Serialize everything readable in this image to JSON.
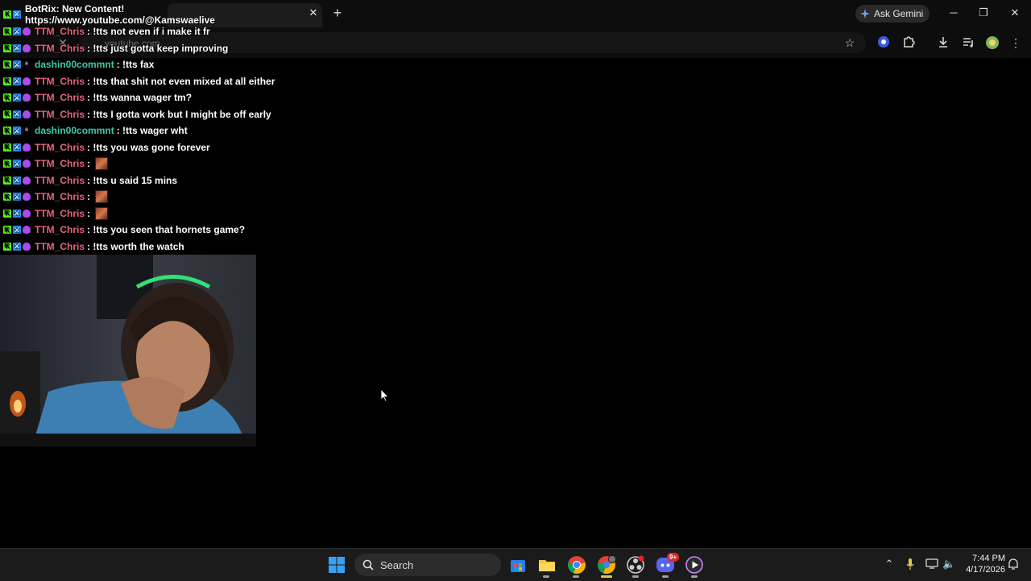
{
  "browser": {
    "tab_title": "BotRix: New Content! https://www.youtube.com/@Kamswaelive",
    "address_text": "youtube.com",
    "gemini_label": "Ask Gemini",
    "window_controls": [
      "minimize-icon",
      "restore-icon",
      "close-icon"
    ],
    "toolbar_icons": [
      "star-icon",
      "extension-circle-icon",
      "puzzle-icon",
      "download-icon",
      "media-queue-icon",
      "profile-avatar-icon",
      "kebab-menu-icon"
    ]
  },
  "chat": {
    "messages": [
      {
        "user": "TTM_Chris",
        "color": "#e8637a",
        "badges": [
          "k",
          "mod",
          "sub"
        ],
        "text": "!tts not even if i make it fr"
      },
      {
        "user": "TTM_Chris",
        "color": "#e8637a",
        "badges": [
          "k",
          "mod",
          "sub"
        ],
        "text": "!tts just gotta keep improving"
      },
      {
        "user": "dashin00commnt",
        "color": "#3ec9a7",
        "badges": [
          "k",
          "mod",
          "dash"
        ],
        "text": "!tts fax"
      },
      {
        "user": "TTM_Chris",
        "color": "#e8637a",
        "badges": [
          "k",
          "mod",
          "sub"
        ],
        "text": "!tts that shit not even mixed at all either"
      },
      {
        "user": "TTM_Chris",
        "color": "#e8637a",
        "badges": [
          "k",
          "mod",
          "sub"
        ],
        "text": "!tts wanna wager tm?"
      },
      {
        "user": "TTM_Chris",
        "color": "#e8637a",
        "badges": [
          "k",
          "mod",
          "sub"
        ],
        "text": "!tts I gotta work but I might be off early"
      },
      {
        "user": "dashin00commnt",
        "color": "#3ec9a7",
        "badges": [
          "k",
          "mod",
          "dash"
        ],
        "text": "!tts wager wht"
      },
      {
        "user": "TTM_Chris",
        "color": "#e8637a",
        "badges": [
          "k",
          "mod",
          "sub"
        ],
        "text": "!tts you was gone forever"
      },
      {
        "user": "TTM_Chris",
        "color": "#e8637a",
        "badges": [
          "k",
          "mod",
          "sub"
        ],
        "text": "",
        "emote": true
      },
      {
        "user": "TTM_Chris",
        "color": "#e8637a",
        "badges": [
          "k",
          "mod",
          "sub"
        ],
        "text": "!tts u said 15 mins"
      },
      {
        "user": "TTM_Chris",
        "color": "#e8637a",
        "badges": [
          "k",
          "mod",
          "sub"
        ],
        "text": "",
        "emote": true
      },
      {
        "user": "TTM_Chris",
        "color": "#e8637a",
        "badges": [
          "k",
          "mod",
          "sub"
        ],
        "text": "",
        "emote": true
      },
      {
        "user": "TTM_Chris",
        "color": "#e8637a",
        "badges": [
          "k",
          "mod",
          "sub"
        ],
        "text": "!tts you seen that hornets game?"
      },
      {
        "user": "TTM_Chris",
        "color": "#e8637a",
        "badges": [
          "k",
          "mod",
          "sub"
        ],
        "text": "!tts worth the watch"
      }
    ],
    "separator": ":"
  },
  "taskbar": {
    "search_placeholder": "Search",
    "apps": [
      "windows-start-icon",
      "microsoft-store-icon",
      "file-explorer-icon",
      "chrome-icon",
      "chrome-profile-icon",
      "obs-icon",
      "discord-icon",
      "media-player-icon"
    ],
    "discord_badge": "9+",
    "time": "7:44 PM",
    "date": "4/17/2026",
    "tray_icons": [
      "chevron-up-icon",
      "microphone-icon",
      "network-icon",
      "volume-icon",
      "notification-bell-icon"
    ]
  }
}
